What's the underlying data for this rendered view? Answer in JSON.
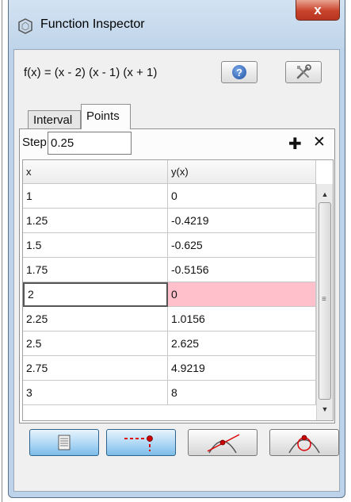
{
  "window": {
    "title": "Function Inspector",
    "close_label": "x"
  },
  "function": {
    "text": "f(x) = (x - 2) (x - 1) (x + 1)"
  },
  "toolbar": {
    "help_glyph": "?"
  },
  "tabs": [
    {
      "label": "Interval",
      "selected": false
    },
    {
      "label": "Points",
      "selected": true
    }
  ],
  "step": {
    "label": "Step:",
    "value": "0.25"
  },
  "table": {
    "columns": [
      "x",
      "y(x)"
    ],
    "rows": [
      {
        "x": "1",
        "y": "0"
      },
      {
        "x": "1.25",
        "y": "-0.4219"
      },
      {
        "x": "1.5",
        "y": "-0.625"
      },
      {
        "x": "1.75",
        "y": "-0.5156"
      },
      {
        "x": "2",
        "y": "0",
        "selected": true
      },
      {
        "x": "2.25",
        "y": "1.0156"
      },
      {
        "x": "2.5",
        "y": "2.625"
      },
      {
        "x": "2.75",
        "y": "4.9219"
      },
      {
        "x": "3",
        "y": "8"
      }
    ]
  },
  "mode_buttons": [
    {
      "icon": "table-icon",
      "active": true
    },
    {
      "icon": "trace-point-icon",
      "active": true
    },
    {
      "icon": "tangent-line-icon",
      "active": false
    },
    {
      "icon": "osculating-circle-icon",
      "active": false
    }
  ],
  "colors": {
    "selected_cell": "#ffc0cb",
    "window_frame": "#bcd3ea",
    "close_button": "#c9432b"
  }
}
